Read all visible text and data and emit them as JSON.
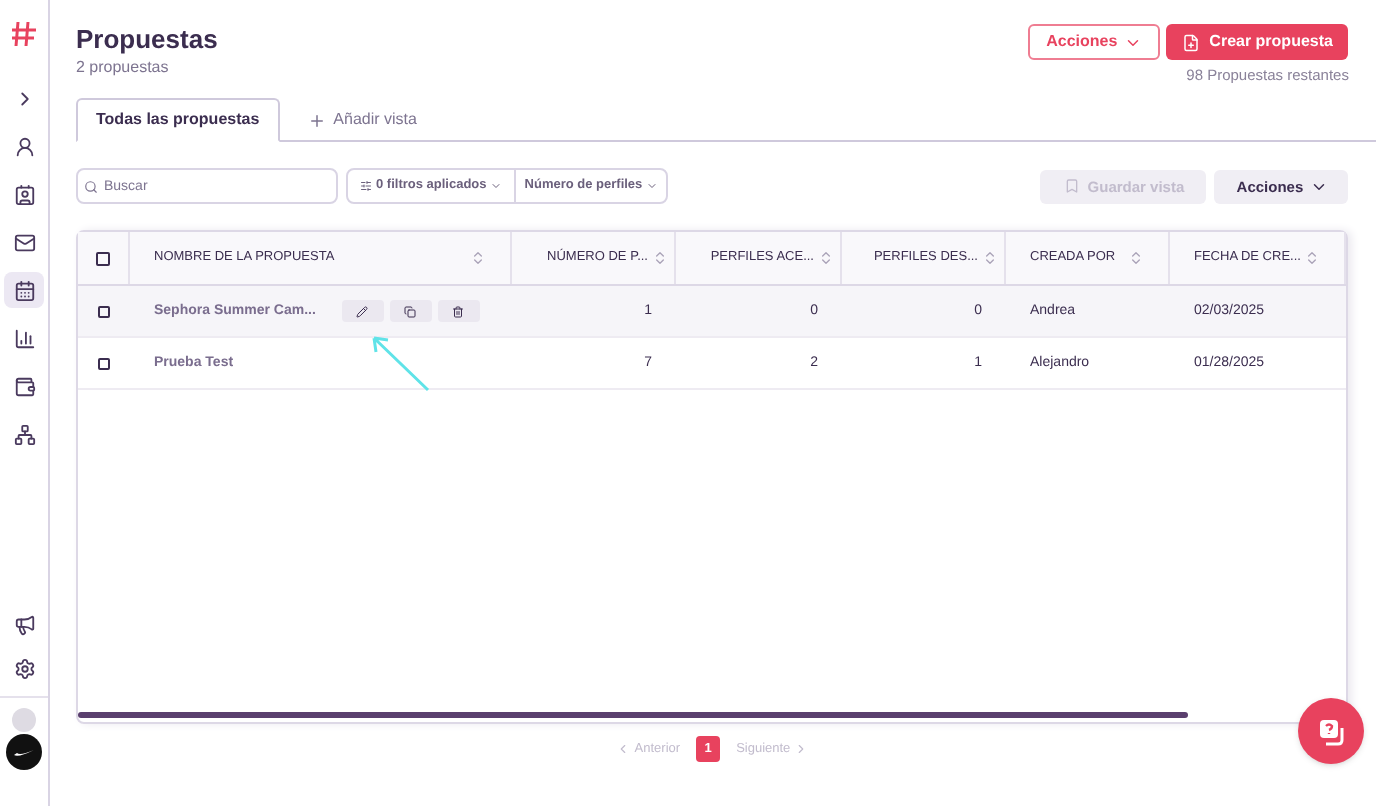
{
  "sidebar": {
    "items": [
      {
        "kind": "expand",
        "selected": false
      },
      {
        "kind": "users",
        "selected": false
      },
      {
        "kind": "contacts",
        "selected": false
      },
      {
        "kind": "mail",
        "selected": false
      },
      {
        "kind": "calendar",
        "selected": true
      },
      {
        "kind": "chart",
        "selected": false
      },
      {
        "kind": "wallet",
        "selected": false
      },
      {
        "kind": "network",
        "selected": false
      }
    ],
    "bottom_items": [
      {
        "kind": "megaphone"
      },
      {
        "kind": "settings"
      }
    ]
  },
  "header": {
    "title": "Propuestas",
    "subtitle": "2 propuestas",
    "actions_button": "Acciones",
    "create_button": "Crear propuesta",
    "remaining": "98 Propuestas restantes"
  },
  "tabs": [
    {
      "label": "Todas las propuestas",
      "selected": true
    },
    {
      "label": "Añadir vista",
      "selected": false,
      "kind": "add"
    }
  ],
  "toolbar": {
    "search_placeholder": "Buscar",
    "filters": "0 filtros aplicados",
    "profiles_filter": "Número de perfiles",
    "save_view": "Guardar vista",
    "save_view_disabled": true,
    "actions": "Acciones"
  },
  "table": {
    "select_all_checked": false,
    "columns": [
      {
        "label": "NOMBRE DE LA PROPUESTA",
        "kind": "text"
      },
      {
        "label": "NÚMERO DE P...",
        "kind": "number"
      },
      {
        "label": "PERFILES ACE...",
        "kind": "number"
      },
      {
        "label": "PERFILES DES...",
        "kind": "number"
      },
      {
        "label": "CREADA POR",
        "kind": "text"
      },
      {
        "label": "FECHA DE CRE...",
        "kind": "text"
      }
    ],
    "rows": [
      {
        "hovered": true,
        "checked": false,
        "cells": [
          "Sephora Summer Cam...",
          "1",
          "0",
          "0",
          "Andrea",
          "02/03/2025"
        ]
      },
      {
        "hovered": false,
        "checked": false,
        "cells": [
          "Prueba Test",
          "7",
          "2",
          "1",
          "Alejandro",
          "01/28/2025"
        ]
      }
    ]
  },
  "pagination": {
    "previous": "Anterior",
    "next": "Siguiente",
    "pages": [
      {
        "label": "1",
        "selected": true
      }
    ]
  }
}
